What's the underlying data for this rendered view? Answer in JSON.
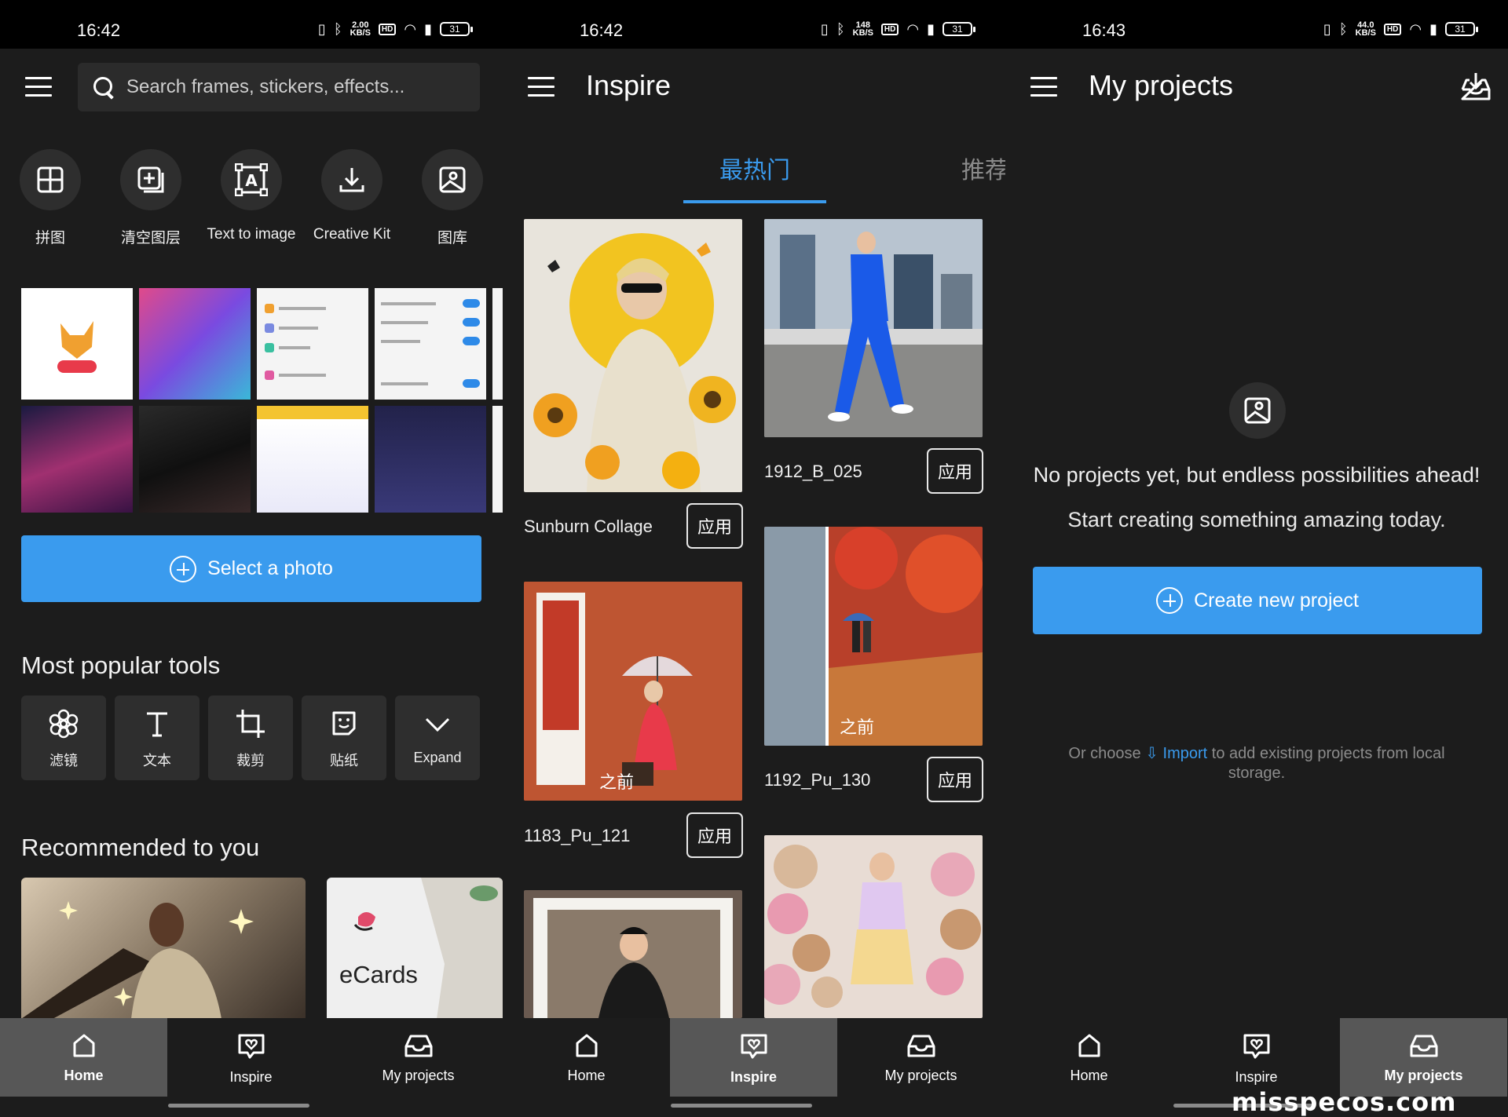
{
  "screens": {
    "home": {
      "status": {
        "time": "16:42",
        "net_speed_top": "2.00",
        "net_speed_unit": "KB/S",
        "battery": "31"
      },
      "search_placeholder": "Search frames, stickers, effects...",
      "quick_actions": [
        {
          "label": "拼图",
          "icon": "grid-icon"
        },
        {
          "label": "清空图层",
          "icon": "layer-plus-icon"
        },
        {
          "label": "Text to image",
          "icon": "text-image-icon"
        },
        {
          "label": "Creative Kit",
          "icon": "download-icon"
        },
        {
          "label": "图库",
          "icon": "gallery-icon"
        }
      ],
      "select_photo_label": "Select a photo",
      "popular_tools_title": "Most popular tools",
      "tools": [
        {
          "label": "滤镜",
          "icon": "flower-icon"
        },
        {
          "label": "文本",
          "icon": "text-icon"
        },
        {
          "label": "裁剪",
          "icon": "crop-icon"
        },
        {
          "label": "贴纸",
          "icon": "sticker-icon"
        },
        {
          "label": "Expand",
          "icon": "chevron-down-icon"
        }
      ],
      "recommended_title": "Recommended to you",
      "recommended": [
        {
          "label": ""
        },
        {
          "label": "eCards"
        }
      ]
    },
    "inspire": {
      "status": {
        "time": "16:42",
        "net_speed_top": "148",
        "net_speed_unit": "KB/S",
        "battery": "31"
      },
      "title": "Inspire",
      "tabs": [
        {
          "label": "最热门",
          "active": true
        },
        {
          "label": "推荐",
          "active": false
        }
      ],
      "cards": [
        {
          "name": "Sunburn Collage",
          "apply": "应用"
        },
        {
          "name": "1912_B_025",
          "apply": "应用"
        },
        {
          "name": "1183_Pu_121",
          "apply": "应用",
          "overlay": "之前"
        },
        {
          "name": "1192_Pu_130",
          "apply": "应用",
          "overlay": "之前"
        }
      ]
    },
    "projects": {
      "status": {
        "time": "16:43",
        "net_speed_top": "44.0",
        "net_speed_unit": "KB/S",
        "battery": "31"
      },
      "title": "My projects",
      "empty_title": "No projects yet, but endless possibilities ahead!",
      "empty_sub": "Start creating something amazing today.",
      "create_label": "Create new project",
      "hint_prefix": "Or choose",
      "hint_link": "Import",
      "hint_suffix": "to add existing projects from local storage."
    }
  },
  "nav": {
    "home": "Home",
    "inspire": "Inspire",
    "projects": "My projects"
  },
  "watermark": "misspecos.com",
  "colors": {
    "accent": "#3a9bee",
    "background": "#1c1c1c",
    "active_nav": "#575757"
  }
}
